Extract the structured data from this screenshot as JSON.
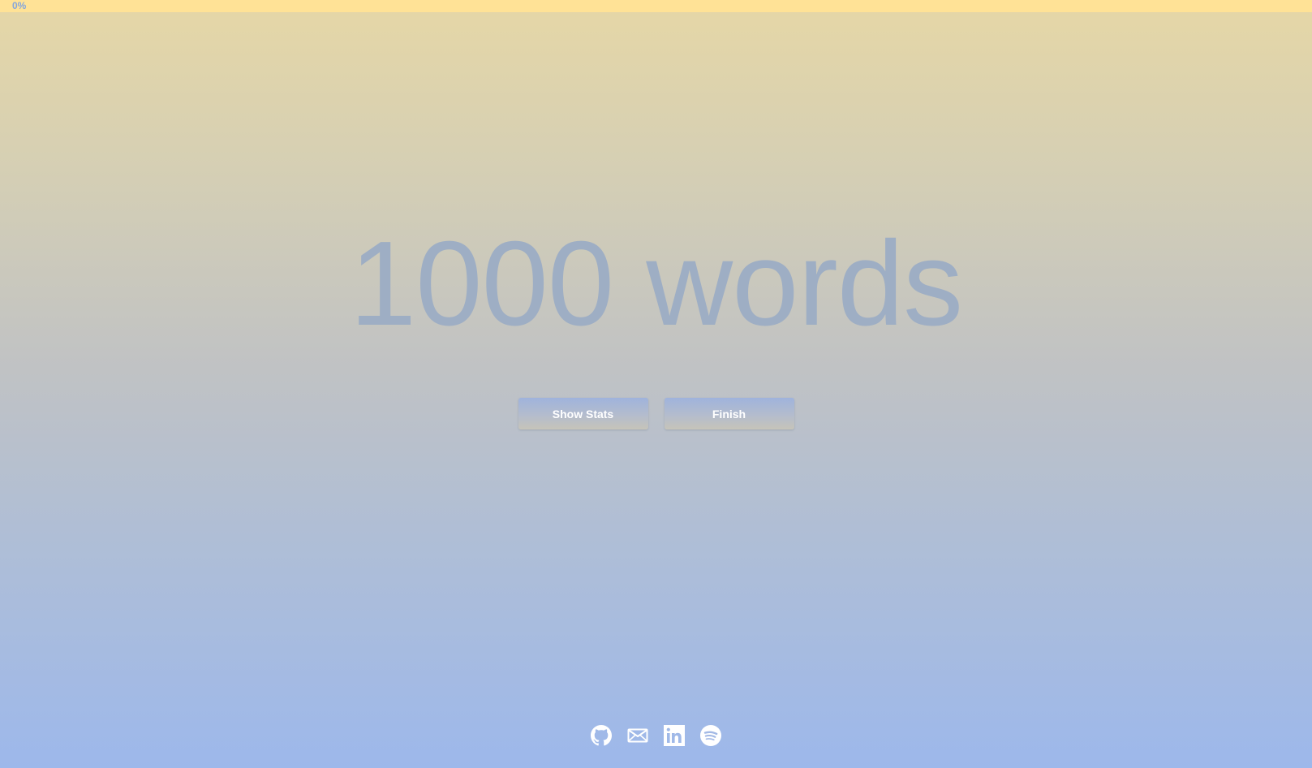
{
  "progress": {
    "label": "0%",
    "value": 0
  },
  "headline": {
    "text": "1000 words"
  },
  "actions": {
    "show_stats_label": "Show Stats",
    "finish_label": "Finish"
  },
  "social": [
    {
      "icon": "github-icon"
    },
    {
      "icon": "mail-icon"
    },
    {
      "icon": "linkedin-icon"
    },
    {
      "icon": "spotify-icon"
    }
  ],
  "colors": {
    "progress_track": "#ffe296",
    "progress_label": "#86a6dc",
    "headline": "#9eaec4",
    "gradient_top": "#e6d7a6",
    "gradient_bottom": "#9db8eb",
    "button_text": "#ffffff",
    "icon": "#ffffff"
  }
}
